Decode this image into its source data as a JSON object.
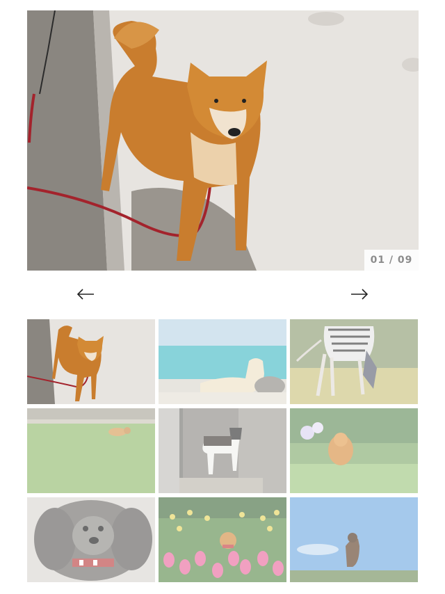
{
  "slider": {
    "counter": "01 / 09",
    "prev_icon": "arrow-left-icon",
    "next_icon": "arrow-right-icon",
    "active_index": 1,
    "total": 9
  },
  "thumbnails": [
    {
      "subject": "shiba-on-pavement",
      "active": true
    },
    {
      "subject": "dog-on-beach",
      "active": false
    },
    {
      "subject": "greyhound-in-sweater",
      "active": false
    },
    {
      "subject": "dog-on-lawn",
      "active": false
    },
    {
      "subject": "dog-in-doorway",
      "active": false
    },
    {
      "subject": "pomeranian-on-grass",
      "active": false
    },
    {
      "subject": "poodle-portrait",
      "active": false
    },
    {
      "subject": "shiba-in-tulips",
      "active": false
    },
    {
      "subject": "dog-under-sky",
      "active": false
    }
  ],
  "colors": {
    "counter_text": "#8c8c8c",
    "arrow": "#222222",
    "background": "#ffffff"
  }
}
